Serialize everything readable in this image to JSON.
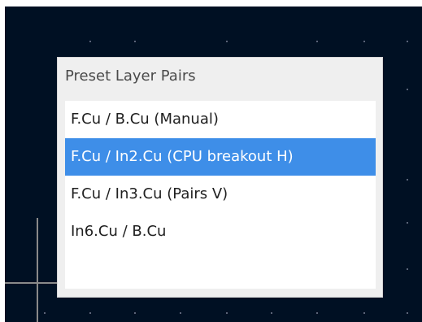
{
  "popup": {
    "title": "Preset Layer Pairs",
    "items": [
      {
        "label": "F.Cu / B.Cu (Manual)",
        "selected": false
      },
      {
        "label": "F.Cu / In2.Cu (CPU breakout H)",
        "selected": true
      },
      {
        "label": "F.Cu / In3.Cu (Pairs V)",
        "selected": false
      },
      {
        "label": "In6.Cu / B.Cu",
        "selected": false
      }
    ]
  },
  "colors": {
    "canvas_background": "#001023",
    "selection": "#3e8ee8",
    "popup_background": "#efefef"
  }
}
